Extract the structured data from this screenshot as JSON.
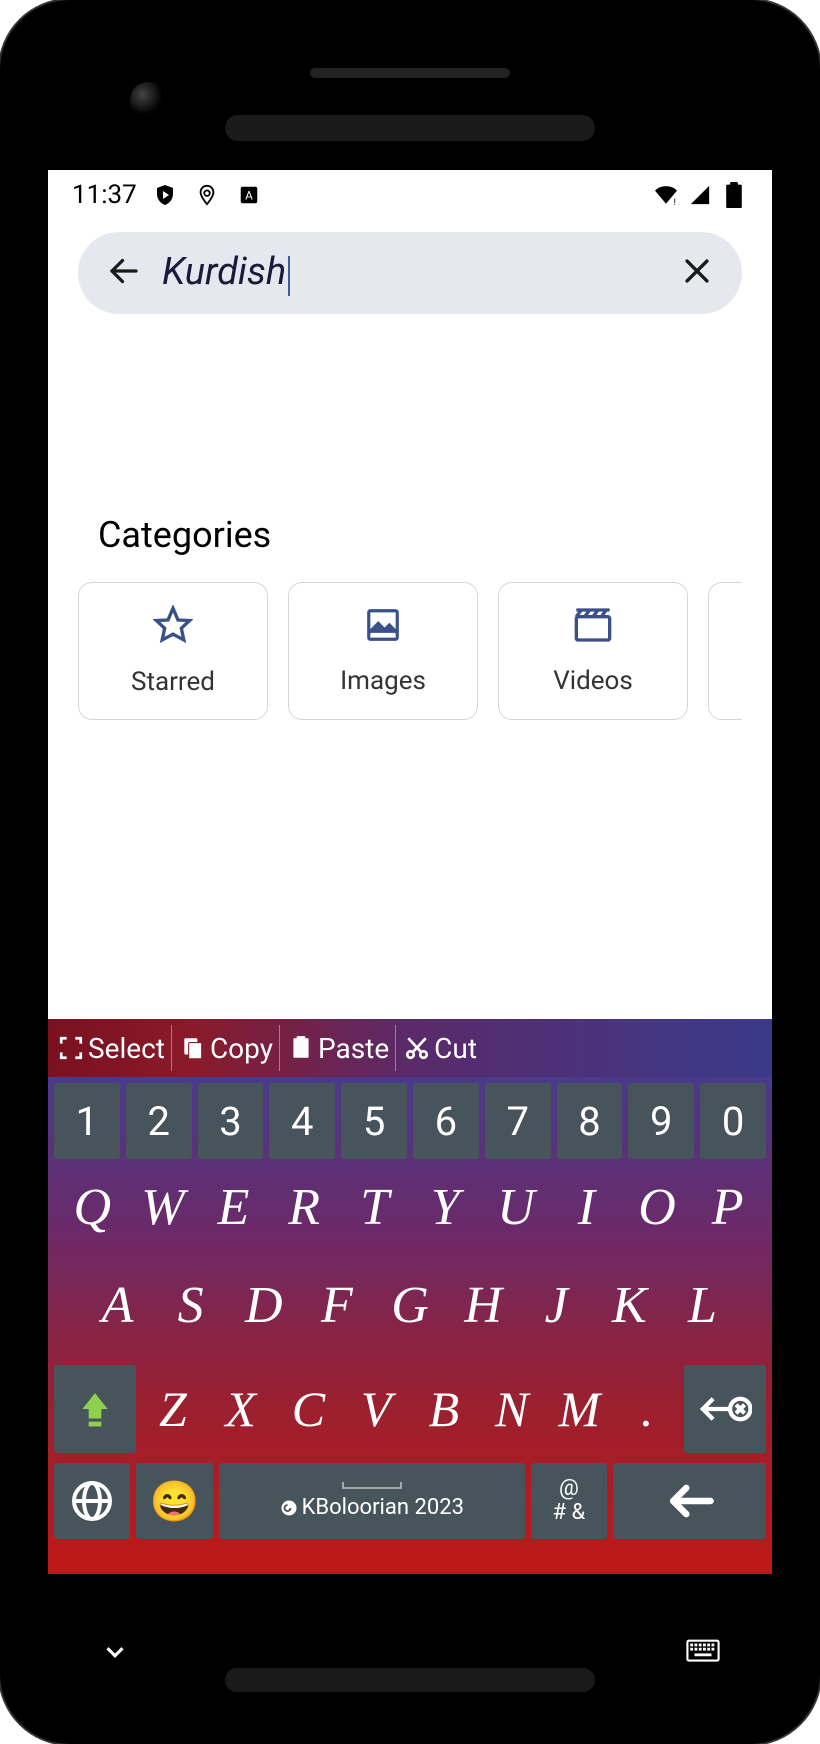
{
  "status": {
    "time": "11:37"
  },
  "search": {
    "value": "Kurdish"
  },
  "content": {
    "categories_heading": "Categories",
    "categories": [
      {
        "label": "Starred",
        "icon": "star"
      },
      {
        "label": "Images",
        "icon": "image"
      },
      {
        "label": "Videos",
        "icon": "video"
      }
    ]
  },
  "keyboard": {
    "toolbar": [
      {
        "label": "Select",
        "icon": "select"
      },
      {
        "label": "Copy",
        "icon": "copy"
      },
      {
        "label": "Paste",
        "icon": "paste"
      },
      {
        "label": "Cut",
        "icon": "cut"
      }
    ],
    "row_numbers": [
      "1",
      "2",
      "3",
      "4",
      "5",
      "6",
      "7",
      "8",
      "9",
      "0"
    ],
    "row_q": [
      "Q",
      "W",
      "E",
      "R",
      "T",
      "Y",
      "U",
      "I",
      "O",
      "P"
    ],
    "row_a": [
      "A",
      "S",
      "D",
      "F",
      "G",
      "H",
      "J",
      "K",
      "L"
    ],
    "row_z": [
      "Z",
      "X",
      "C",
      "V",
      "B",
      "N",
      "M",
      "."
    ],
    "space_label": "KBoloorian 2023",
    "symbols_top": "@",
    "symbols_bottom": "# &"
  }
}
